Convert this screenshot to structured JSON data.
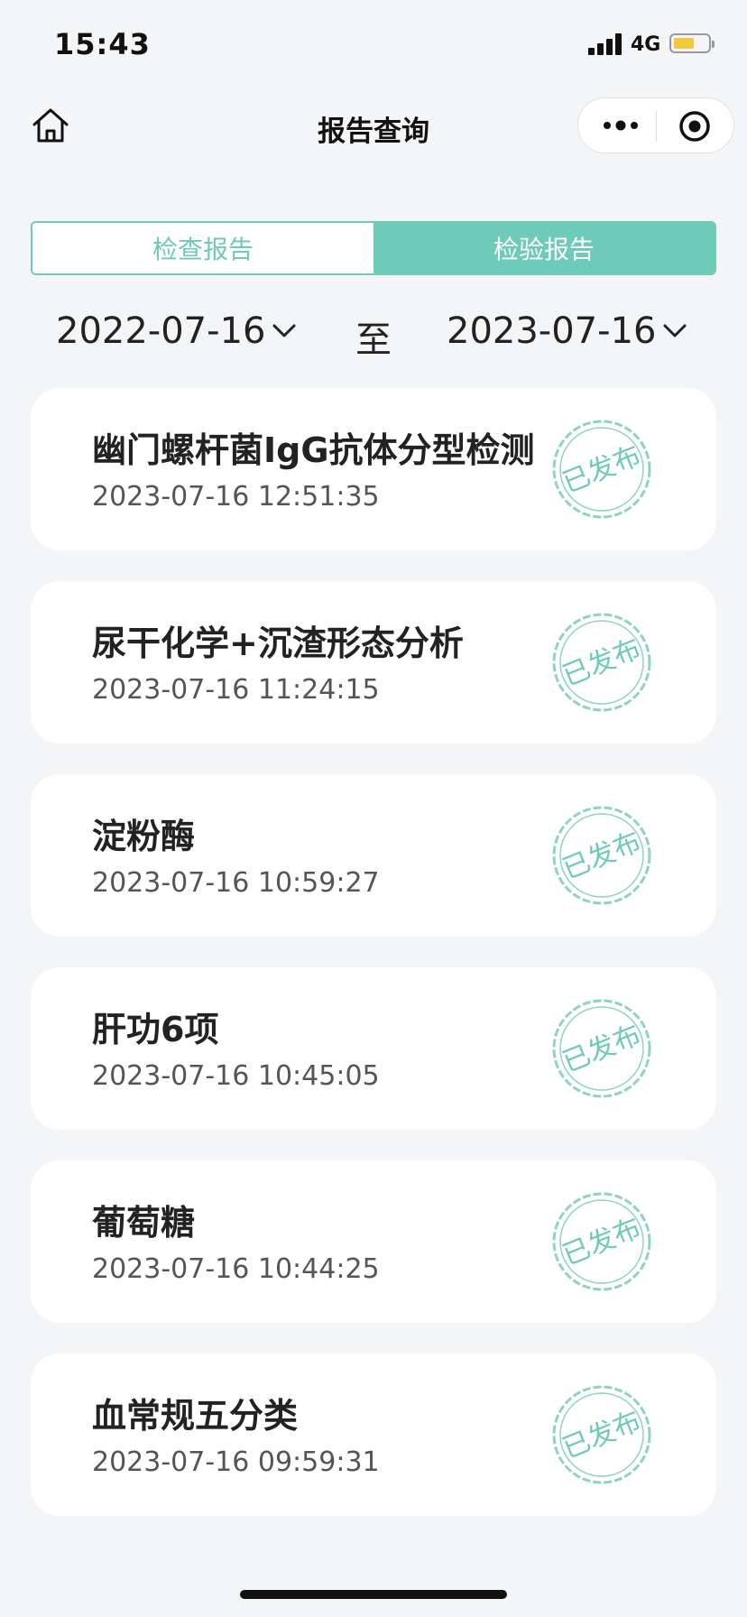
{
  "status_bar": {
    "time": "15:43",
    "network": "4G"
  },
  "nav": {
    "title": "报告查询"
  },
  "tabs": [
    {
      "label": "检查报告",
      "active": false
    },
    {
      "label": "检验报告",
      "active": true
    }
  ],
  "date_filter": {
    "start": "2022-07-16",
    "separator": "至",
    "end": "2023-07-16"
  },
  "reports": [
    {
      "title": "幽门螺杆菌IgG抗体分型检测",
      "time": "2023-07-16 12:51:35",
      "status": "已发布"
    },
    {
      "title": "尿干化学+沉渣形态分析",
      "time": "2023-07-16 11:24:15",
      "status": "已发布"
    },
    {
      "title": "淀粉酶",
      "time": "2023-07-16 10:59:27",
      "status": "已发布"
    },
    {
      "title": "肝功6项",
      "time": "2023-07-16 10:45:05",
      "status": "已发布"
    },
    {
      "title": "葡萄糖",
      "time": "2023-07-16 10:44:25",
      "status": "已发布"
    },
    {
      "title": "血常规五分类",
      "time": "2023-07-16 09:59:31",
      "status": "已发布"
    }
  ],
  "colors": {
    "accent": "#6ecbb8",
    "background": "#f4f5f7",
    "battery": "#f2c83e"
  }
}
